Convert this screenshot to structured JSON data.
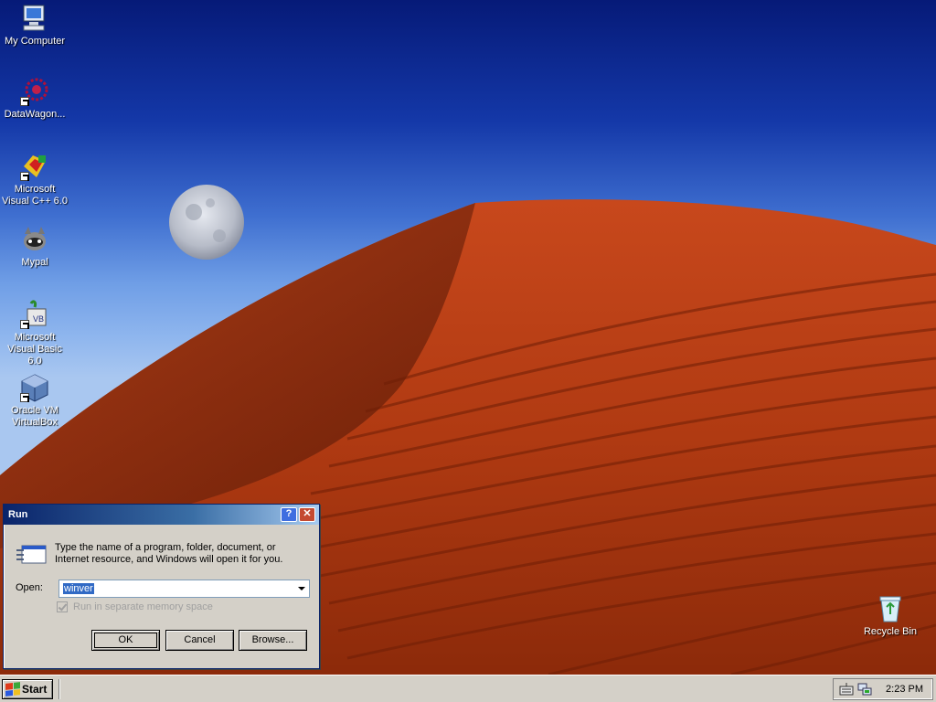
{
  "desktop": {
    "icons": [
      {
        "label": "My Computer",
        "icon": "computer-icon"
      },
      {
        "label": "DataWagon...",
        "icon": "datawagon-icon"
      },
      {
        "label": "Microsoft Visual C++ 6.0",
        "icon": "visual-cpp-icon"
      },
      {
        "label": "Mypal",
        "icon": "mypal-icon"
      },
      {
        "label": "Microsoft Visual Basic 6.0",
        "icon": "visual-basic-icon"
      },
      {
        "label": "Oracle VM VirtualBox",
        "icon": "virtualbox-icon"
      }
    ],
    "recycle_bin": {
      "label": "Recycle Bin",
      "icon": "recycle-bin-icon"
    }
  },
  "run_dialog": {
    "title": "Run",
    "help_button": "?",
    "close_button": "✕",
    "description": "Type the name of a program, folder, document, or Internet resource, and Windows will open it for you.",
    "open_label": "Open:",
    "open_value": "winver",
    "checkbox_label": "Run in separate memory space",
    "checkbox_checked": true,
    "checkbox_enabled": false,
    "ok_label": "OK",
    "cancel_label": "Cancel",
    "browse_label": "Browse..."
  },
  "taskbar": {
    "start_label": "Start",
    "clock": "2:23 PM",
    "tray_icons": [
      "keyboard-icon",
      "network-icon"
    ]
  },
  "colors": {
    "titlebar_start": "#0a246a",
    "titlebar_end": "#a6caf0",
    "face": "#d4d0c8",
    "selection": "#316ac5"
  }
}
